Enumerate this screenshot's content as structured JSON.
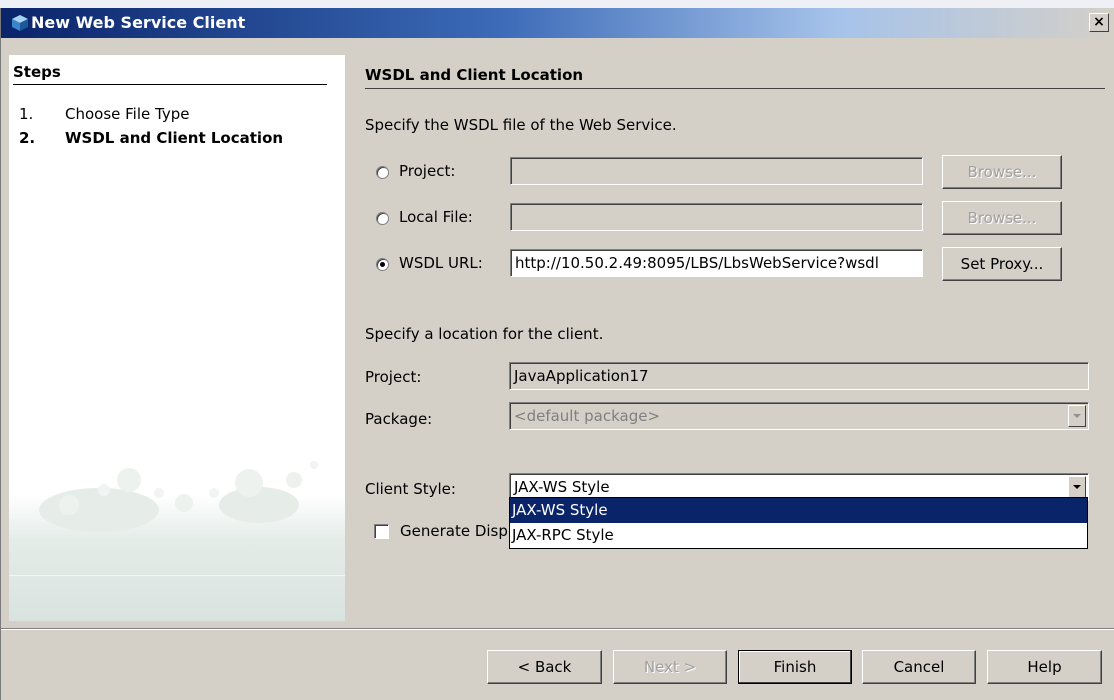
{
  "window": {
    "title": "New Web Service Client",
    "close_label": "×"
  },
  "steps": {
    "heading": "Steps",
    "items": [
      {
        "num": "1.",
        "label": "Choose File Type"
      },
      {
        "num": "2.",
        "label": "WSDL and Client Location"
      }
    ]
  },
  "panel": {
    "title": "WSDL and Client Location",
    "wsdl_instructions": "Specify the WSDL file of the Web Service.",
    "project_radio_label": "Project:",
    "project_value": "",
    "local_file_radio_label": "Local File:",
    "local_file_value": "",
    "wsdl_url_radio_label": "WSDL URL:",
    "wsdl_url_value": "http://10.50.2.49:8095/LBS/LbsWebService?wsdl",
    "browse_label_1": "Browse...",
    "browse_label_2": "Browse...",
    "set_proxy_label": "Set Proxy...",
    "location_instructions": "Specify a location for the client.",
    "project_label": "Project:",
    "project_name": "JavaApplication17",
    "package_label": "Package:",
    "package_value": "<default package>",
    "client_style_label": "Client Style:",
    "client_style_value": "JAX-WS Style",
    "client_style_options": [
      "JAX-WS Style",
      "JAX-RPC Style"
    ],
    "generate_checkbox_label": "Generate Disp"
  },
  "footer": {
    "back_label": "< Back",
    "next_label": "Next >",
    "finish_label": "Finish",
    "cancel_label": "Cancel",
    "help_label": "Help"
  }
}
